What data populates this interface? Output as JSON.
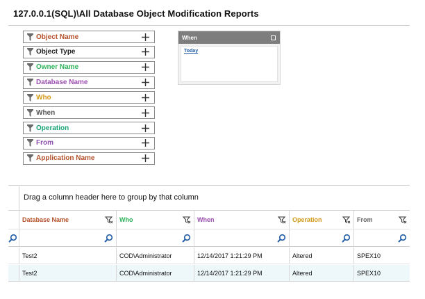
{
  "page": {
    "title": "127.0.0.1(SQL)\\All Database Object Modification Reports"
  },
  "filters": [
    {
      "label": "Object Name",
      "color": "#b5502a"
    },
    {
      "label": "Object Type",
      "color": "#222222"
    },
    {
      "label": "Owner Name",
      "color": "#2fb35a"
    },
    {
      "label": "Database Name",
      "color": "#9b4fb0"
    },
    {
      "label": "Who",
      "color": "#d49a1a"
    },
    {
      "label": "When",
      "color": "#555555"
    },
    {
      "label": "Operation",
      "color": "#1aa374"
    },
    {
      "label": "From",
      "color": "#8e4fb0"
    },
    {
      "label": "Application Name",
      "color": "#b5502a"
    }
  ],
  "when_panel": {
    "title": "When",
    "link": "Today"
  },
  "grid": {
    "group_hint": "Drag a column header here to group by that column",
    "columns": [
      {
        "label": "Database Name",
        "color": "#b5502a"
      },
      {
        "label": "Who",
        "color": "#2fb35a"
      },
      {
        "label": "When",
        "color": "#9b4fb0"
      },
      {
        "label": "Operation",
        "color": "#d49a1a"
      },
      {
        "label": "From",
        "color": "#666666"
      }
    ],
    "rows": [
      [
        "Test2",
        "COD\\Administrator",
        "12/14/2017 1:21:29 PM",
        "Altered",
        "SPEX10"
      ],
      [
        "Test2",
        "COD\\Administrator",
        "12/14/2017 1:21:29 PM",
        "Altered",
        "SPEX10"
      ]
    ]
  }
}
